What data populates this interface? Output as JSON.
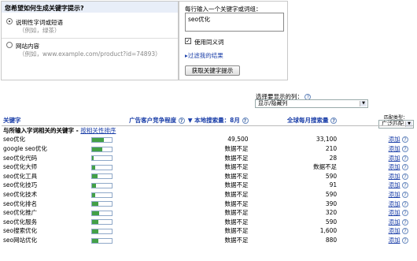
{
  "question": {
    "title": "您希望如何生成关键字提示?",
    "option1": {
      "label": "说明性字词或短语",
      "hint": "（例如，绿茶）",
      "selected": true
    },
    "option2": {
      "label": "网站内容",
      "hint": "（例如，www.example.com/product?id=74893）",
      "selected": false
    }
  },
  "input_panel": {
    "instruction": "每行输入一个关键字或词组：",
    "keyword_text": "seo优化",
    "synonyms_label": "使用同义词",
    "synonyms_checked": true,
    "filter_link": "过滤我的结果",
    "submit_label": "获取关键字提示"
  },
  "columns_select": {
    "label": "选择要显示的列：",
    "value": "显示/隐藏列"
  },
  "match_type": {
    "label": "匹配类型：",
    "value": "广泛匹配"
  },
  "table": {
    "headers": {
      "keyword": "关键字",
      "competition": "广告客户竞争程度",
      "local": "▼ 本地搜索量：8月",
      "global": "全球每月搜索量"
    },
    "group_row": {
      "text": "与所输入字词相关的关键字 - ",
      "link": "按相关性排序"
    },
    "add_label": "添加",
    "rows": [
      {
        "keyword": "seo优化",
        "competition": 0.6,
        "local": "49,500",
        "global": "33,100"
      },
      {
        "keyword": "google seo优化",
        "competition": 0.5,
        "local": "数据不足",
        "global": "210"
      },
      {
        "keyword": "seo优化代码",
        "competition": 0.05,
        "local": "数据不足",
        "global": "28"
      },
      {
        "keyword": "seo优化大师",
        "competition": 0.15,
        "local": "数据不足",
        "global": "数据不足"
      },
      {
        "keyword": "seo优化工具",
        "competition": 0.25,
        "local": "数据不足",
        "global": "590"
      },
      {
        "keyword": "seo优化技巧",
        "competition": 0.2,
        "local": "数据不足",
        "global": "91"
      },
      {
        "keyword": "seo优化技术",
        "competition": 0.15,
        "local": "数据不足",
        "global": "590"
      },
      {
        "keyword": "seo优化排名",
        "competition": 0.3,
        "local": "数据不足",
        "global": "390"
      },
      {
        "keyword": "seo优化推广",
        "competition": 0.35,
        "local": "数据不足",
        "global": "320"
      },
      {
        "keyword": "seo优化服务",
        "competition": 0.3,
        "local": "数据不足",
        "global": "590"
      },
      {
        "keyword": "seo搜索优化",
        "competition": 0.3,
        "local": "数据不足",
        "global": "1,600"
      },
      {
        "keyword": "seo网站优化",
        "competition": 0.3,
        "local": "数据不足",
        "global": "880"
      }
    ]
  },
  "colors": {
    "accent": "#1a3ea8",
    "bar_fill": "#43a047",
    "header_bg": "#e8eef8"
  }
}
